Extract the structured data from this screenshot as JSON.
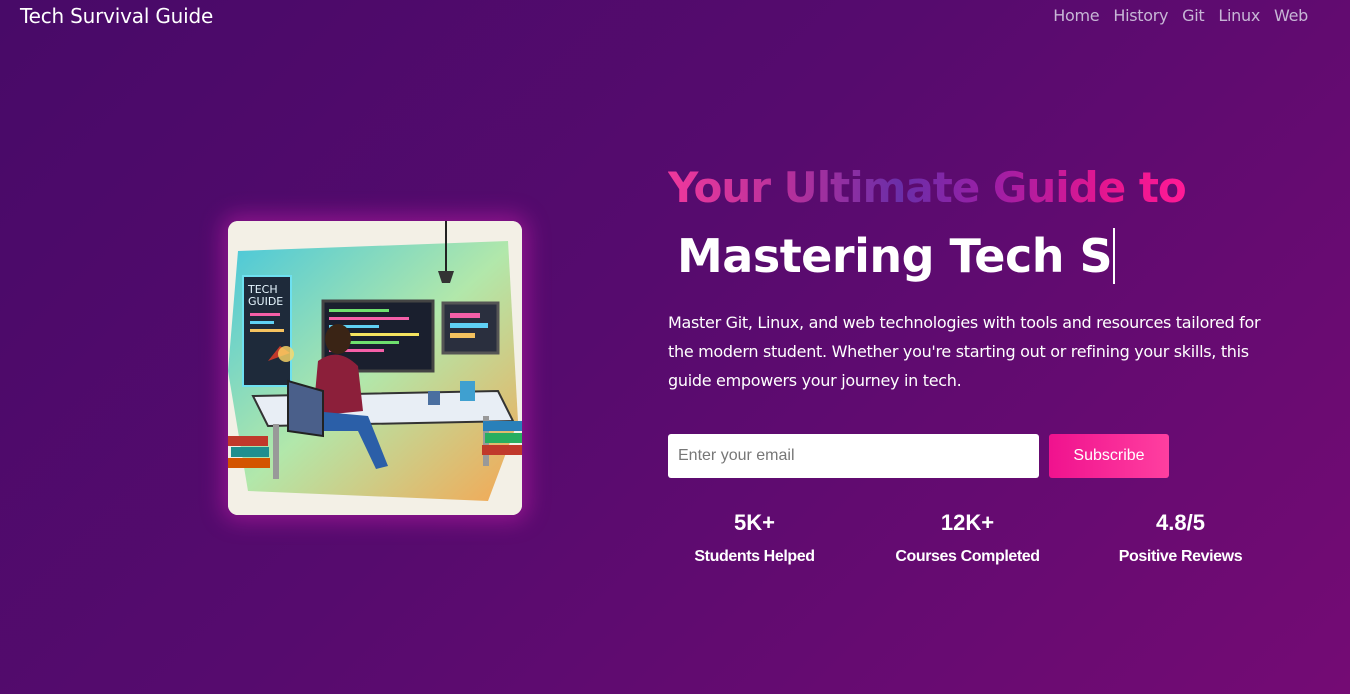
{
  "brand": "Tech Survival Guide",
  "nav": [
    "Home",
    "History",
    "Git",
    "Linux",
    "Web"
  ],
  "hero": {
    "heading_line1": "Your Ultimate Guide to",
    "heading_line2": "Mastering Tech S",
    "description": "Master Git, Linux, and web technologies with tools and resources tailored for the modern student. Whether you're starting out or refining your skills, this guide empowers your journey in tech.",
    "image_text": "TECH GUIDE"
  },
  "subscribe": {
    "placeholder": "Enter your email",
    "button_label": "Subscribe"
  },
  "stats": [
    {
      "value": "5K+",
      "label": "Students Helped"
    },
    {
      "value": "12K+",
      "label": "Courses Completed"
    },
    {
      "value": "4.8/5",
      "label": "Positive Reviews"
    }
  ],
  "colors": {
    "accent": "#f0128e",
    "background_start": "#480a68",
    "background_end": "#740b74"
  }
}
